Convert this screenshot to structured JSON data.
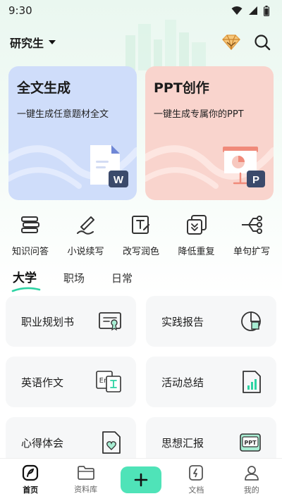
{
  "status_bar": {
    "time": "9:30"
  },
  "header": {
    "grade": "研究生"
  },
  "cards": [
    {
      "title": "全文生成",
      "subtitle": "一键生成任意题材全文",
      "badge": "W"
    },
    {
      "title": "PPT创作",
      "subtitle": "一键生成专属你的PPT",
      "badge": "P"
    }
  ],
  "tools": [
    {
      "label": "知识问答",
      "icon": "books-icon"
    },
    {
      "label": "小说续写",
      "icon": "pen-icon"
    },
    {
      "label": "改写润色",
      "icon": "text-edit-icon"
    },
    {
      "label": "降低重复",
      "icon": "reduce-duplicate-icon"
    },
    {
      "label": "单句扩写",
      "icon": "expand-icon"
    }
  ],
  "tabs": [
    "大学",
    "职场",
    "日常"
  ],
  "templates": [
    {
      "label": "职业规划书",
      "icon": "certificate-icon"
    },
    {
      "label": "实践报告",
      "icon": "report-chart-icon"
    },
    {
      "label": "英语作文",
      "icon": "translate-icon",
      "icon_text": "En"
    },
    {
      "label": "活动总结",
      "icon": "bar-doc-icon"
    },
    {
      "label": "心得体会",
      "icon": "heart-doc-icon"
    },
    {
      "label": "思想汇报",
      "icon": "ppt-icon",
      "icon_text": "PPT"
    }
  ],
  "bottom_nav": {
    "home": "首页",
    "library": "资料库",
    "docs": "文档",
    "mine": "我的"
  },
  "colors": {
    "accent": "#4fe3b8",
    "card_blue": "#cfddfa",
    "card_pink": "#f9d4cd",
    "badge_navy": "#3b4a6b"
  }
}
